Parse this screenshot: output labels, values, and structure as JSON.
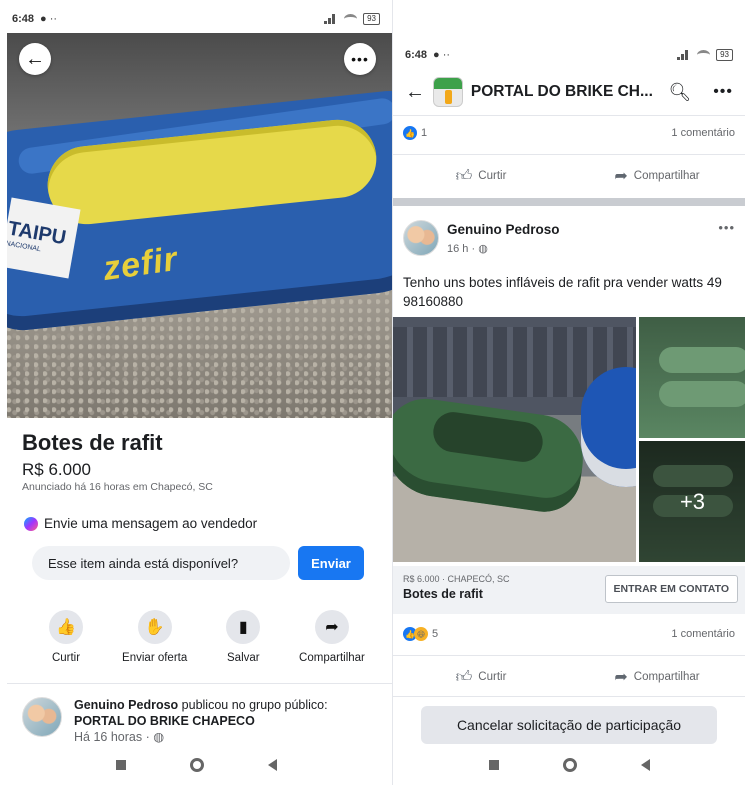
{
  "left": {
    "status": {
      "time": "6:48",
      "battery": "93"
    },
    "listing": {
      "title": "Botes de rafit",
      "price": "R$ 6.000",
      "meta": "Anunciado há 16 horas em Chapecó, SC"
    },
    "photo_text": {
      "brand": "zefir",
      "tag": "TAIPU",
      "tag_small": "NACIONAL"
    },
    "message": {
      "heading": "Envie uma mensagem ao vendedor",
      "input_value": "Esse item ainda está disponível?",
      "send_label": "Enviar"
    },
    "actions": [
      {
        "label": "Curtir",
        "icon": "thumbs-up-icon"
      },
      {
        "label": "Enviar oferta",
        "icon": "offer-icon"
      },
      {
        "label": "Salvar",
        "icon": "bookmark-icon"
      },
      {
        "label": "Compartilhar",
        "icon": "share-icon"
      }
    ],
    "group_post": {
      "author": "Genuino Pedroso",
      "verb": " publicou no grupo público:",
      "group": "PORTAL DO BRIKE CHAPECO",
      "time": "Há 16 horas · "
    }
  },
  "right": {
    "status": {
      "time": "6:48",
      "battery": "93"
    },
    "header": {
      "title": "PORTAL DO BRIKE CH..."
    },
    "prev_post": {
      "reactions": "1",
      "comments": "1 comentário"
    },
    "actions": {
      "like": "Curtir",
      "share": "Compartilhar"
    },
    "post": {
      "author": "Genuino Pedroso",
      "time": "16 h · ",
      "text": "Tenho uns botes infláveis de rafit pra vender watts 49 98160880",
      "more_photos": "+3",
      "reactions": "5",
      "comments": "1 comentário"
    },
    "listing_card": {
      "meta": "R$ 6.000 · CHAPECÓ, SC",
      "title": "Botes de rafit",
      "contact_label": "ENTRAR EM CONTATO"
    },
    "cancel_label": "Cancelar solicitação de participação"
  },
  "colors": {
    "accent": "#1877f2",
    "card_bg": "#f0f2f5",
    "muted": "#65676b"
  }
}
